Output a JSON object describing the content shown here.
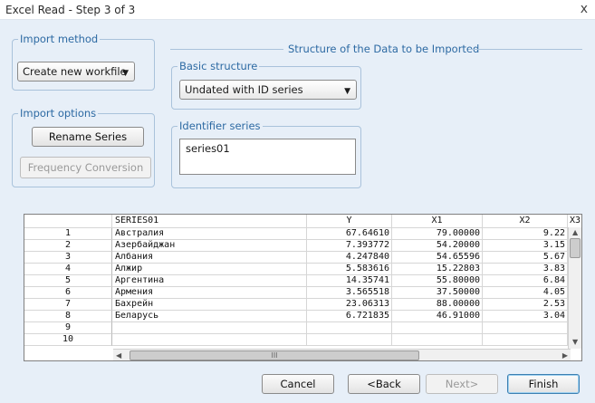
{
  "window": {
    "title": "Excel Read - Step 3 of 3",
    "close_glyph": "x"
  },
  "import_method": {
    "legend": "Import method",
    "value": "Create new workfile"
  },
  "structure": {
    "heading": "Structure of the Data to be Imported",
    "basic_legend": "Basic structure",
    "basic_value": "Undated with ID series",
    "identifier_legend": "Identifier series",
    "identifier_value": "series01"
  },
  "import_options": {
    "legend": "Import options",
    "rename_label": "Rename Series",
    "frequency_label": "Frequency Conversion"
  },
  "grid": {
    "columns": [
      "SERIES01",
      "Y",
      "X1",
      "X2",
      "X3"
    ],
    "rows": [
      {
        "n": "1",
        "series": "Австралия",
        "y": "67.64610",
        "x1": "79.00000",
        "x2": "9.22"
      },
      {
        "n": "2",
        "series": "Азербайджан",
        "y": "7.393772",
        "x1": "54.20000",
        "x2": "3.15"
      },
      {
        "n": "3",
        "series": "Албания",
        "y": "4.247840",
        "x1": "54.65596",
        "x2": "5.67"
      },
      {
        "n": "4",
        "series": "Алжир",
        "y": "5.583616",
        "x1": "15.22803",
        "x2": "3.83"
      },
      {
        "n": "5",
        "series": "Аргентина",
        "y": "14.35741",
        "x1": "55.80000",
        "x2": "6.84"
      },
      {
        "n": "6",
        "series": "Армения",
        "y": "3.565518",
        "x1": "37.50000",
        "x2": "4.05"
      },
      {
        "n": "7",
        "series": "Бахрейн",
        "y": "23.06313",
        "x1": "88.00000",
        "x2": "2.53"
      },
      {
        "n": "8",
        "series": "Беларусь",
        "y": "6.721835",
        "x1": "46.91000",
        "x2": "3.04"
      },
      {
        "n": "9",
        "series": "",
        "y": "",
        "x1": "",
        "x2": ""
      },
      {
        "n": "10",
        "series": "",
        "y": "",
        "x1": "",
        "x2": ""
      }
    ],
    "hscroll_grip": "III"
  },
  "buttons": {
    "cancel": "Cancel",
    "back": "<Back",
    "next": "Next>",
    "finish": "Finish"
  }
}
